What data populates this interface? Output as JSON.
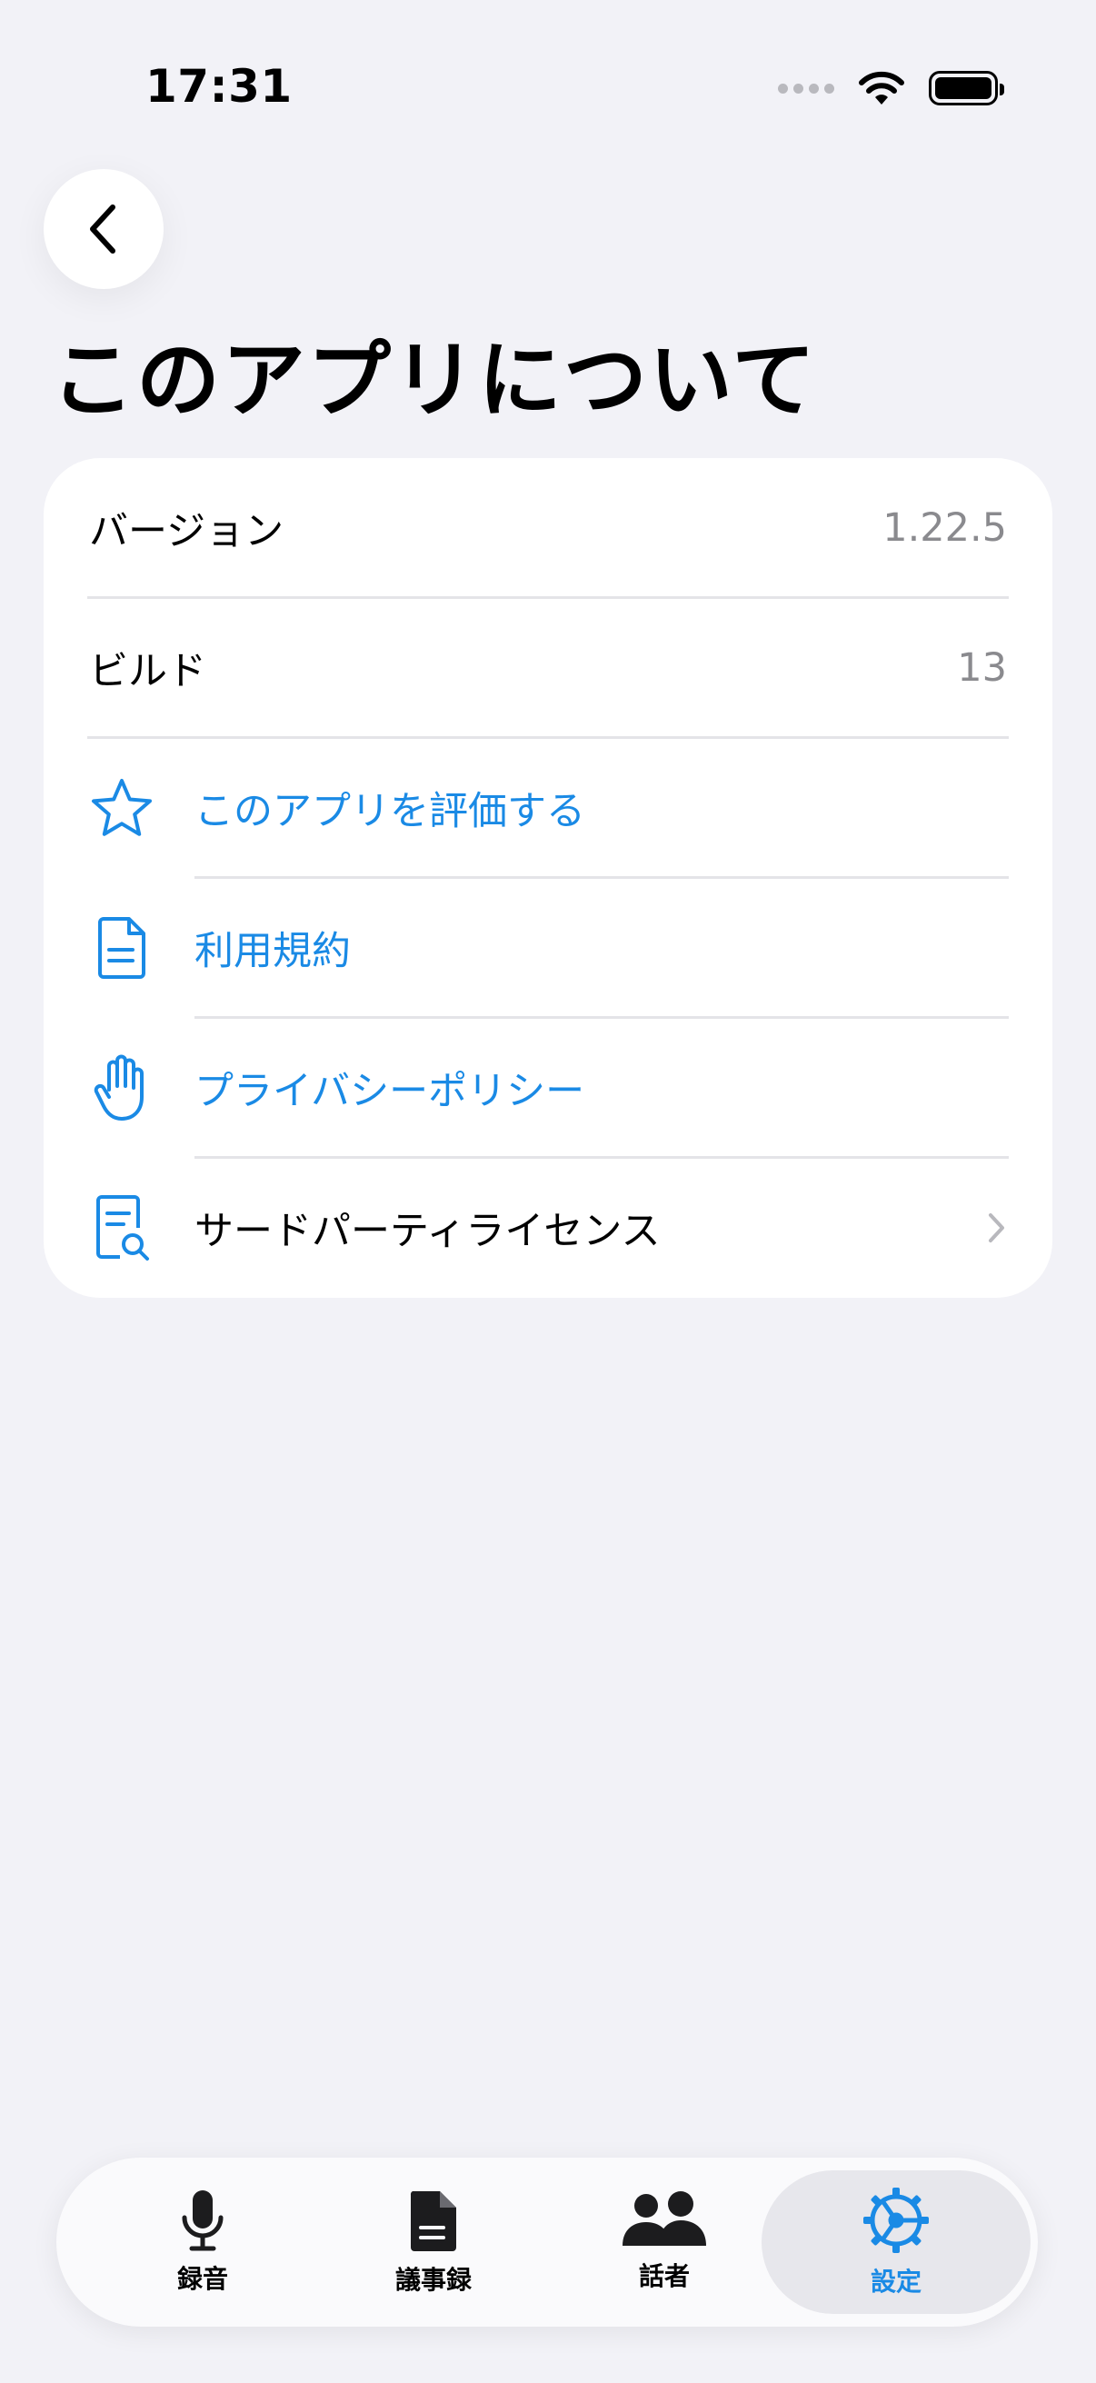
{
  "status_bar": {
    "time": "17:31"
  },
  "header": {
    "title": "このアプリについて"
  },
  "about": {
    "version_label": "バージョン",
    "version_value": "1.22.5",
    "build_label": "ビルド",
    "build_value": "13",
    "rate_label": "このアプリを評価する",
    "terms_label": "利用規約",
    "privacy_label": "プライバシーポリシー",
    "licenses_label": "サードパーティライセンス"
  },
  "tabs": [
    {
      "label": "録音",
      "icon": "microphone-icon"
    },
    {
      "label": "議事録",
      "icon": "document-icon"
    },
    {
      "label": "話者",
      "icon": "people-icon"
    },
    {
      "label": "設定",
      "icon": "gear-icon"
    }
  ],
  "colors": {
    "accent": "#1a8ae5",
    "background": "#f2f2f7"
  }
}
